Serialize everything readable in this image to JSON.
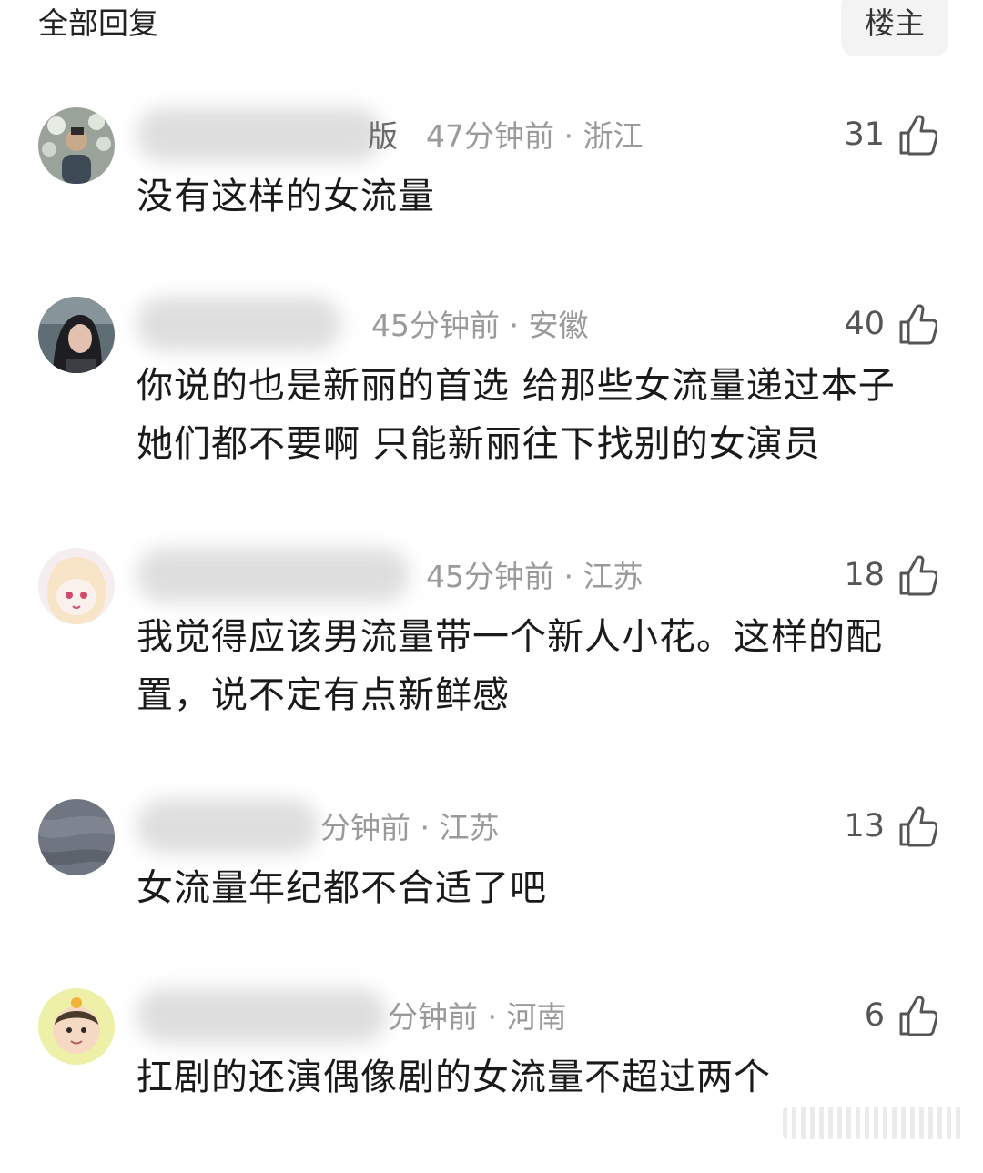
{
  "header": {
    "title": "全部回复",
    "op_filter_label": "楼主"
  },
  "comments": [
    {
      "meta": "47分钟前 · 浙江",
      "username_tail": "版",
      "likes": "31",
      "text": "没有这样的女流量"
    },
    {
      "meta": "45分钟前 · 安徽",
      "username_tail": "",
      "likes": "40",
      "text": "你说的也是新丽的首选 给那些女流量递过本子 她们都不要啊 只能新丽往下找别的女演员"
    },
    {
      "meta": "45分钟前 · 江苏",
      "username_tail": "",
      "likes": "18",
      "text": "我觉得应该男流量带一个新人小花。这样的配置，说不定有点新鲜感"
    },
    {
      "meta": "分钟前 · 江苏",
      "username_tail": "",
      "likes": "13",
      "text": "女流量年纪都不合适了吧"
    },
    {
      "meta": "分钟前 · 河南",
      "username_tail": "",
      "likes": "6",
      "text": "扛剧的还演偶像剧的女流量不超过两个"
    }
  ],
  "icons": {
    "like": "thumbs-up-icon"
  },
  "colors": {
    "meta_gray": "#9a9a9a",
    "text": "#1a1a1a",
    "filter_bg": "#f3f3f3"
  }
}
